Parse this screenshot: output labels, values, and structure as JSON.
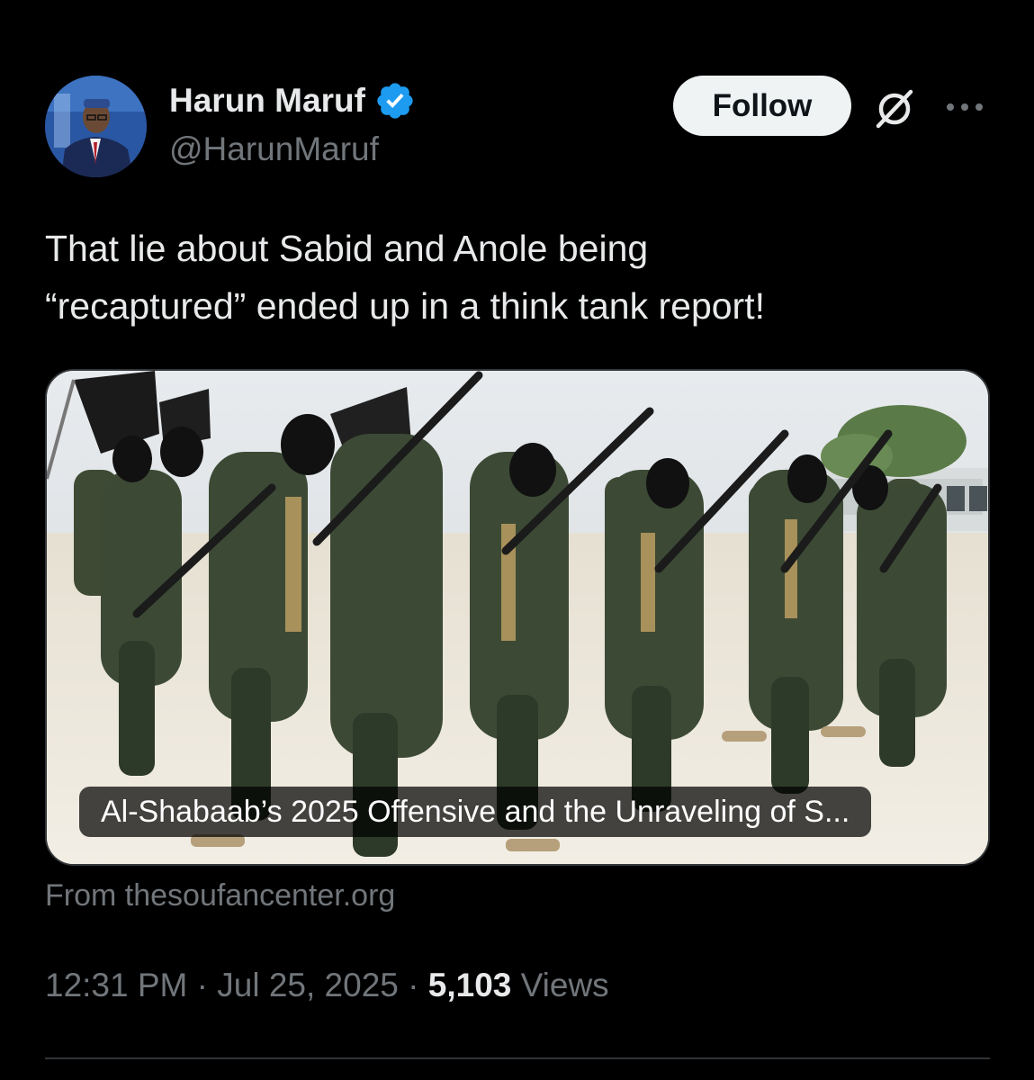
{
  "author": {
    "display_name": "Harun Maruf",
    "handle": "@HarunMaruf",
    "verified": true
  },
  "actions": {
    "follow_label": "Follow"
  },
  "icons": {
    "verified": "verified-badge-icon",
    "grok": "grok-icon",
    "more": "more-options-icon"
  },
  "tweet": {
    "text": "That lie about Sabid and Anole being\n“recaptured” ended up in a think tank report!"
  },
  "link_card": {
    "title": "Al-Shabaab’s 2025 Offensive and the Unraveling of S...",
    "source": "From thesoufancenter.org"
  },
  "meta": {
    "time": "12:31 PM",
    "separator": " · ",
    "date": "Jul 25, 2025",
    "views_count": "5,103",
    "views_label": "Views"
  },
  "colors": {
    "background": "#000000",
    "text_primary": "#e7e9ea",
    "text_secondary": "#71767b",
    "verified_blue": "#1d9bf0",
    "follow_bg": "#eff3f4",
    "border": "#333639"
  }
}
